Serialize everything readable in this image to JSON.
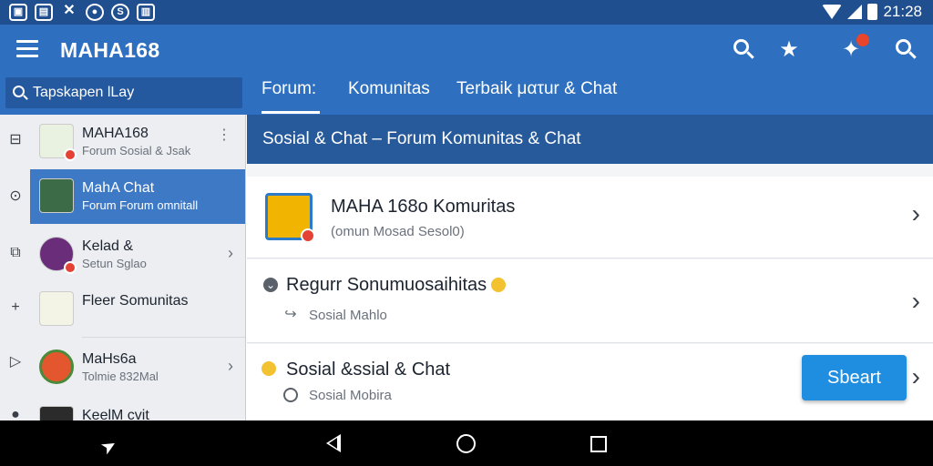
{
  "status_bar": {
    "time": "21:28",
    "left_icons": [
      "sd-card-icon",
      "save-icon",
      "tools-icon",
      "compass-icon",
      "sync-icon",
      "storage-icon"
    ]
  },
  "app_bar": {
    "title": "MAHA168",
    "icons": [
      "search-icon",
      "star-icon",
      "notification-star-icon",
      "search-icon"
    ]
  },
  "search": {
    "placeholder": "Tapskapen lLay"
  },
  "tabs": [
    {
      "label": "Forum:"
    },
    {
      "label": "Komunitas"
    },
    {
      "label": "Terbaik ματur & Chat"
    }
  ],
  "sidebar": {
    "items": [
      {
        "title": "MAHA168",
        "subtitle": "Forum Sosial & Jsak"
      },
      {
        "title": "MahA Chat",
        "subtitle": "Forum Forum omnitall"
      },
      {
        "title": "Kelad &",
        "subtitle": "Setun Sglao"
      },
      {
        "title": "Fleer Somunitas",
        "subtitle": ""
      },
      {
        "title": "MaHs6a",
        "subtitle": "Tolmie 832Mal"
      },
      {
        "title": "KeelM cvit",
        "subtitle": ""
      }
    ]
  },
  "main": {
    "section_title": "Sosial & Chat – Forum Komunitas & Chat",
    "cards": [
      {
        "title": "MAHA 168o Komuritas",
        "subtitle": "(omun Mosad Sesol0)"
      },
      {
        "title": "Regurr Sonumuosaihitas",
        "subtitle": "Sosial Mahlo"
      },
      {
        "title": "Sosial &ssial & Chat",
        "subtitle": "Sosial Mobira"
      }
    ],
    "start_button": "Sbeart"
  },
  "colors": {
    "status_bar": "#1f4f8f",
    "app_bar": "#2e6fbf",
    "section_header": "#275a9b",
    "sidebar_active": "#3e79c5",
    "start_button": "#1f8de0"
  }
}
